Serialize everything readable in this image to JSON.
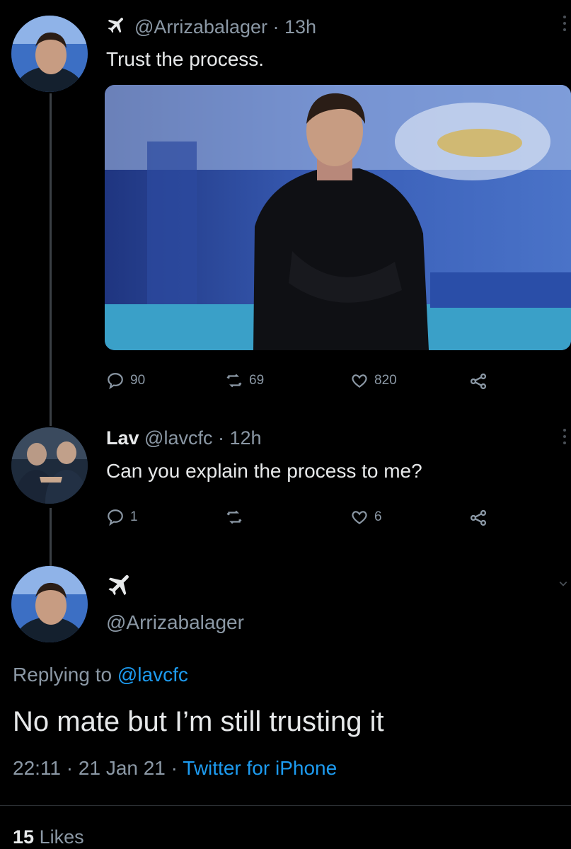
{
  "tweet1": {
    "handle": "@Arrizabalager",
    "time": "13h",
    "text": "Trust the process.",
    "avatar_icon": "profile-photo",
    "name_icon": "airplane-icon",
    "actions": {
      "replies": "90",
      "retweets": "69",
      "likes": "820"
    }
  },
  "tweet2": {
    "name": "Lav",
    "handle": "@lavcfc",
    "time": "12h",
    "text": "Can you explain the process to me?",
    "actions": {
      "replies": "1",
      "retweets": "",
      "likes": "6"
    }
  },
  "main_tweet": {
    "handle": "@Arrizabalager",
    "name_icon": "airplane-icon",
    "replying_to_label": "Replying to",
    "replying_to_handle": "@lavcfc",
    "text": "No mate but I’m still trusting it",
    "time": "22:11",
    "date": "21 Jan 21",
    "source": "Twitter for iPhone",
    "likes_count": "15",
    "likes_label": "Likes"
  },
  "colors": {
    "background": "#000000",
    "link": "#1d9bf0",
    "muted": "#8b98a5",
    "text": "#e7e9ea"
  }
}
